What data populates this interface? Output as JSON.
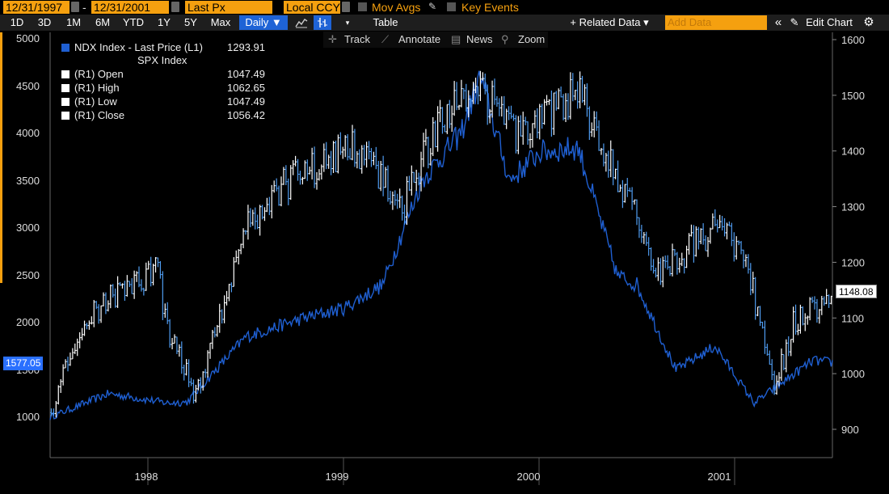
{
  "toolbar": {
    "start_date": "12/31/1997",
    "date_separator": "-",
    "end_date": "12/31/2001",
    "price_field": "Last Px",
    "currency": "Local CCY",
    "mov_avgs": "Mov Avgs",
    "key_events": "Key Events"
  },
  "ranges": {
    "items": [
      "1D",
      "3D",
      "1M",
      "6M",
      "YTD",
      "1Y",
      "5Y",
      "Max"
    ],
    "frequency": "Daily ▼",
    "table": "Table",
    "related": "+ Related Data ▾",
    "add_data_placeholder": "Add Data",
    "edit_chart": "Edit Chart"
  },
  "tools": {
    "track": "Track",
    "annotate": "Annotate",
    "news": "News",
    "zoom": "Zoom"
  },
  "legend": {
    "ndx_label": "NDX Index - Last Price (L1)",
    "ndx_value": "1293.91",
    "spx_title": "SPX Index",
    "rows": [
      {
        "label": "(R1) Open",
        "value": "1047.49"
      },
      {
        "label": "(R1) High",
        "value": "1062.65"
      },
      {
        "label": "(R1) Low",
        "value": "1047.49"
      },
      {
        "label": "(R1) Close",
        "value": "1056.42"
      }
    ]
  },
  "axes": {
    "left_flag": "1577.05",
    "right_flag": "1148.08"
  },
  "colors": {
    "toolbar_field": "#f5a00f",
    "ndx_line": "#1f5fd1",
    "spx_line": "#4f9cf0",
    "selected_button": "#1e63d6",
    "flag": "#2a70ff"
  },
  "chart_data": {
    "type": "line",
    "title": "",
    "x_labels": [
      "1998",
      "1999",
      "2000",
      "2001"
    ],
    "left_axis": {
      "ticks": [
        1000,
        1500,
        2000,
        2500,
        3000,
        3500,
        4000,
        4500,
        5000
      ],
      "range": [
        900,
        5000
      ]
    },
    "right_axis": {
      "ticks": [
        900,
        1000,
        1100,
        1200,
        1300,
        1400,
        1500,
        1600
      ],
      "range": [
        880,
        1600
      ]
    },
    "grid": false,
    "legend_position": "top-left",
    "series": [
      {
        "name": "NDX Index - Last Price (L1)",
        "axis": "left",
        "x": [
          1998.0,
          1998.3,
          1998.6,
          1998.7,
          1999.0,
          1999.3,
          1999.5,
          1999.7,
          1999.9,
          2000.1,
          2000.2,
          2000.35,
          2000.5,
          2000.7,
          2000.9,
          2001.0,
          2001.2,
          2001.4,
          2001.6,
          2001.7,
          2001.9,
          2002.0
        ],
        "values": [
          1000,
          1250,
          1150,
          1160,
          1850,
          2050,
          2150,
          2400,
          3500,
          4000,
          4600,
          3500,
          3800,
          3850,
          2500,
          2400,
          1500,
          1750,
          1150,
          1300,
          1600,
          1577
        ]
      },
      {
        "name": "SPX Index",
        "axis": "right",
        "type": "ohlc",
        "x": [
          1998.0,
          1998.2,
          1998.55,
          1998.6,
          1998.75,
          1999.0,
          1999.2,
          1999.55,
          1999.8,
          2000.0,
          2000.2,
          2000.4,
          2000.7,
          2000.9,
          2001.0,
          2001.1,
          2001.4,
          2001.55,
          2001.7,
          2001.8,
          2002.0
        ],
        "values": [
          930,
          1110,
          1190,
          1080,
          960,
          1270,
          1340,
          1410,
          1300,
          1460,
          1510,
          1420,
          1510,
          1350,
          1300,
          1180,
          1260,
          1220,
          965,
          1090,
          1148
        ]
      }
    ]
  }
}
